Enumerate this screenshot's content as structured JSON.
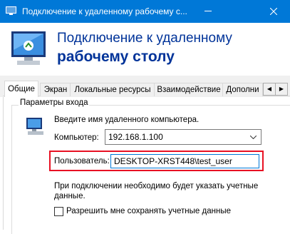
{
  "window": {
    "title": "Подключение к удаленному рабочему с...",
    "minimize_icon": "minimize-icon",
    "close_icon": "close-icon",
    "app_icon": "remote-desktop-icon"
  },
  "header": {
    "line1": "Подключение к удаленному",
    "line2": "рабочему столу",
    "icon": "remote-desktop-connection-icon"
  },
  "tabs": [
    {
      "label": "Общие",
      "active": true
    },
    {
      "label": "Экран",
      "active": false
    },
    {
      "label": "Локальные ресурсы",
      "active": false
    },
    {
      "label": "Взаимодействие",
      "active": false
    },
    {
      "label": "Дополни",
      "active": false
    }
  ],
  "tab_scroll": {
    "left_icon": "scroll-left-icon",
    "right_icon": "scroll-right-icon"
  },
  "logon": {
    "legend": "Параметры входа",
    "intro": "Введите имя удаленного компьютера.",
    "computer_label": "Компьютер:",
    "computer_value": "192.168.1.100",
    "user_label": "Пользователь:",
    "user_value": "DESKTOP-XRST448\\test_user",
    "note": "При подключении необходимо будет указать учетные данные.",
    "save_label": "Разрешить мне сохранять учетные данные",
    "save_checked": false
  },
  "colors": {
    "titlebar": "#0078d7",
    "header_text": "#003399",
    "highlight": "#e81123"
  }
}
